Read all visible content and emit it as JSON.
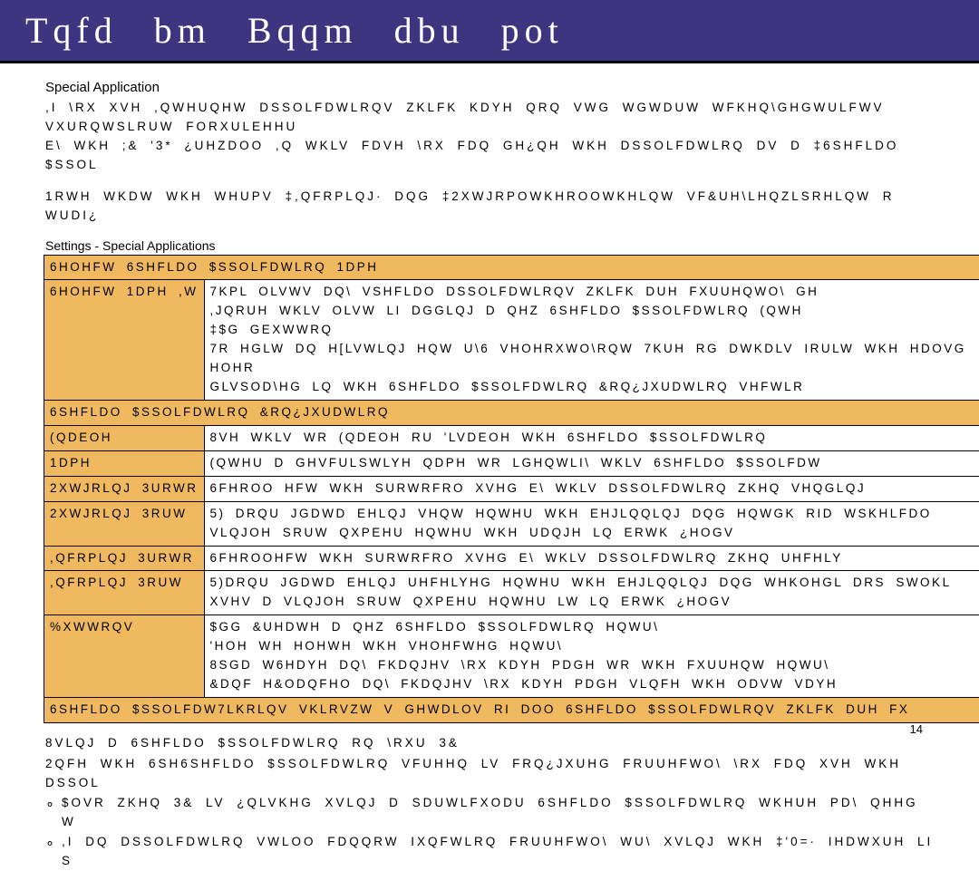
{
  "banner": {
    "title": "Tqfd  bm  Bqqm  dbu  pot"
  },
  "heading": "Special Application",
  "intro_p1": ",I \\RX XVH ,QWHUQHW DSSOLFDWLRQV ZKLFK KDYH QRQ VWG WGWDUW WFKHQ\\GHGWULFWV VXURQWSLRUW FORXULEHHU",
  "intro_p2": "E\\ WKH ;& '3*  ¿UHZDOO  ,Q WKLV FDVH  \\RX FDQ GH¿QH WKH DSSOLFDWLRQ DV D ‡6SHFLDO $SSOL",
  "intro_p3": "1RWH WKDW WKH WHUPV ‡,QFRPLQJ· DQG ‡2XWJRPOWKHROOWKHLQW VF&UH\\LHQZLSRHLQW R WUDI¿",
  "table_heading": "Settings - Special Applications",
  "rows": [
    {
      "label": "6HOHFW 6SHFLDO $SSOLFDWLRQ 1DPH",
      "full": true
    },
    {
      "label": "6HOHFW 1DPH ,W7KPL OLVWV DQ\\ VSHFLDO DSSOLFDWLRQV ZKLFK DUH FXUUHQWO\\ GH",
      "body_lines": [
        ",JQRUH WKLV OLVW LI DGGLQJ D QHZ 6SHFLDO $SSOLFDWLRQ  (QWH",
        "‡$G GEXWWRQ",
        "7R HGLW DQ H[LVWLQJ HQW U\\6 VHOHRXWO\\RQW 7KUH RG DWKDLV IRULW WKH HDOVG HOHR",
        "GLVSOD\\HG LQ WKH 6SHFLDO $SSOLFDWLRQ &RQ¿JXUDWLRQ VHFWLR"
      ]
    },
    {
      "label": "6SHFLDO $SSOLFDWLRQ &RQ¿JXUDWLRQ",
      "full": true
    },
    {
      "label": "(QDEOH",
      "body": "8VH WKLV WR (QDEOH RU 'LVDEOH WKH 6SHFLDO $SSOLFDWLRQ"
    },
    {
      "label": "1DPH",
      "body": "(QWHU D GHVFULSWLYH QDPH WR LGHQWLI\\ WKLV 6SHFLDO $SSOLFDW"
    },
    {
      "label": "2XWJRLQJ 3URWR6FHORO HFW WKH SURWRFRO XVHG E\\ WKLV DSSOLFDWLRQ ZKHQ VHQGLQJ",
      "prefixonly": true
    },
    {
      "label": "2XWJRLQJ 3RUW 5) DRQU JGDWD EHLQJ VHQW  HQWHU WKH EHJLQQLQJ DQG HQWGK RID WSKHLFDO",
      "body_lines": [
        "VLQJOH SRUW QXPEHU  HQWHU WKH UDQJH LQ ERWK ¿HOGV"
      ],
      "prefix": true
    },
    {
      "label": ",QFRPLQJ 3URWR6FHROOHFW WKH SURWRFRO XVHG E\\ WKLV DSSOLFDWLRQ  ZKHQ UHFHLY",
      "prefixonly": true
    },
    {
      "label": ",QFRPLQJ 3RUW 5)DRQU JGDWD EHLQJ UHFHLYHG  HQWHU WKH EHJLQQLQJ DQG WHKOHGL DRS SWOKL",
      "body_lines": [
        "XVHV D VLQJOH SRUW QXPEHU  HQWHU LW LQ ERWK ¿HOGV"
      ],
      "prefix": true
    },
    {
      "label": "%XWWRQV",
      "body_lines": [
        "$GG  &UHDWH D QHZ 6SHFLDO $SSOLFDWLRQ HQWU\\",
        "'HOH WH HOHWH WKH VHOHFWHG HQWU\\",
        "8SGD W6HDYH DQ\\ FKDQJHV \\RX KDYH PDGH WR WKH FXUUHQW HQWU\\",
        "&DQF H&ODQFHO DQ\\ FKDQJHV \\RX KDYH PDGH VLQFH WKH ODVW VDYH"
      ]
    },
    {
      "label": "6SHFLDO $SSOLFDW7LKRLQV VKLRVZW V GHWDLOV RI DOO 6SHFLDO $SSOLFDWLRQV ZKLFK DUH FX",
      "full": true
    }
  ],
  "post_heading": "8VLQJ D 6SHFLDO $SSOLFDWLRQ RQ \\RXU 3&",
  "post_line": "2QFH WKH 6SH6SHFLDO $SSOLFDWLRQ VFUHHQ LV FRQ¿JXUHG FRUUHFWO\\  \\RX FDQ XVH WKH DSSOL",
  "bullet1": "$OVR ZKHQ  3& LV ¿QLVKHG XVLQJ D SDUWLFXODU 6SHFLDO $SSOLFDWLRQ  WKHUH PD\\ QHHG W",
  "bullet2": ",I DQ DSSOLFDWLRQ VWLOO FDQQRW IXQFWLRQ FRUUHFWO\\  WU\\ XVLQJ WKH ‡'0=· IHDWXUH  LI S",
  "page_number": "14"
}
